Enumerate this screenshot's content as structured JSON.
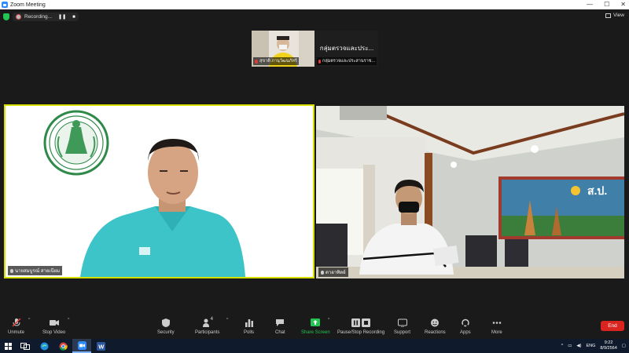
{
  "window": {
    "title": "Zoom Meeting"
  },
  "recording": {
    "label": "Recording..."
  },
  "view": {
    "label": "View"
  },
  "thumbnails": [
    {
      "name": "สุขาติ ภานุวัฒนภัทร์",
      "muted": true
    },
    {
      "name": "กลุ่มตรวจและประสานราช...",
      "title": "กลุ่มตรวจและประ...",
      "muted": true
    }
  ],
  "tiles": {
    "left": {
      "name": "นายสมบูรณ์ สายเนียม"
    },
    "right": {
      "name": "ตาอาทิตย์"
    }
  },
  "toolbar": {
    "unmute": "Unmute",
    "stop_video": "Stop Video",
    "security": "Security",
    "participants": "Participants",
    "participants_count": "4",
    "polls": "Polls",
    "chat": "Chat",
    "share_screen": "Share Screen",
    "pause_recording": "Pause/Stop Recording",
    "support": "Support",
    "reactions": "Reactions",
    "apps": "Apps",
    "more": "More",
    "end": "End"
  },
  "taskbar": {
    "language": "ENG",
    "time": "9:22",
    "date": "8/9/2564"
  },
  "colors": {
    "active_speaker_border": "#d6e000",
    "end_button": "#d9241f",
    "share_screen": "#23c552",
    "shield": "#23c552"
  }
}
